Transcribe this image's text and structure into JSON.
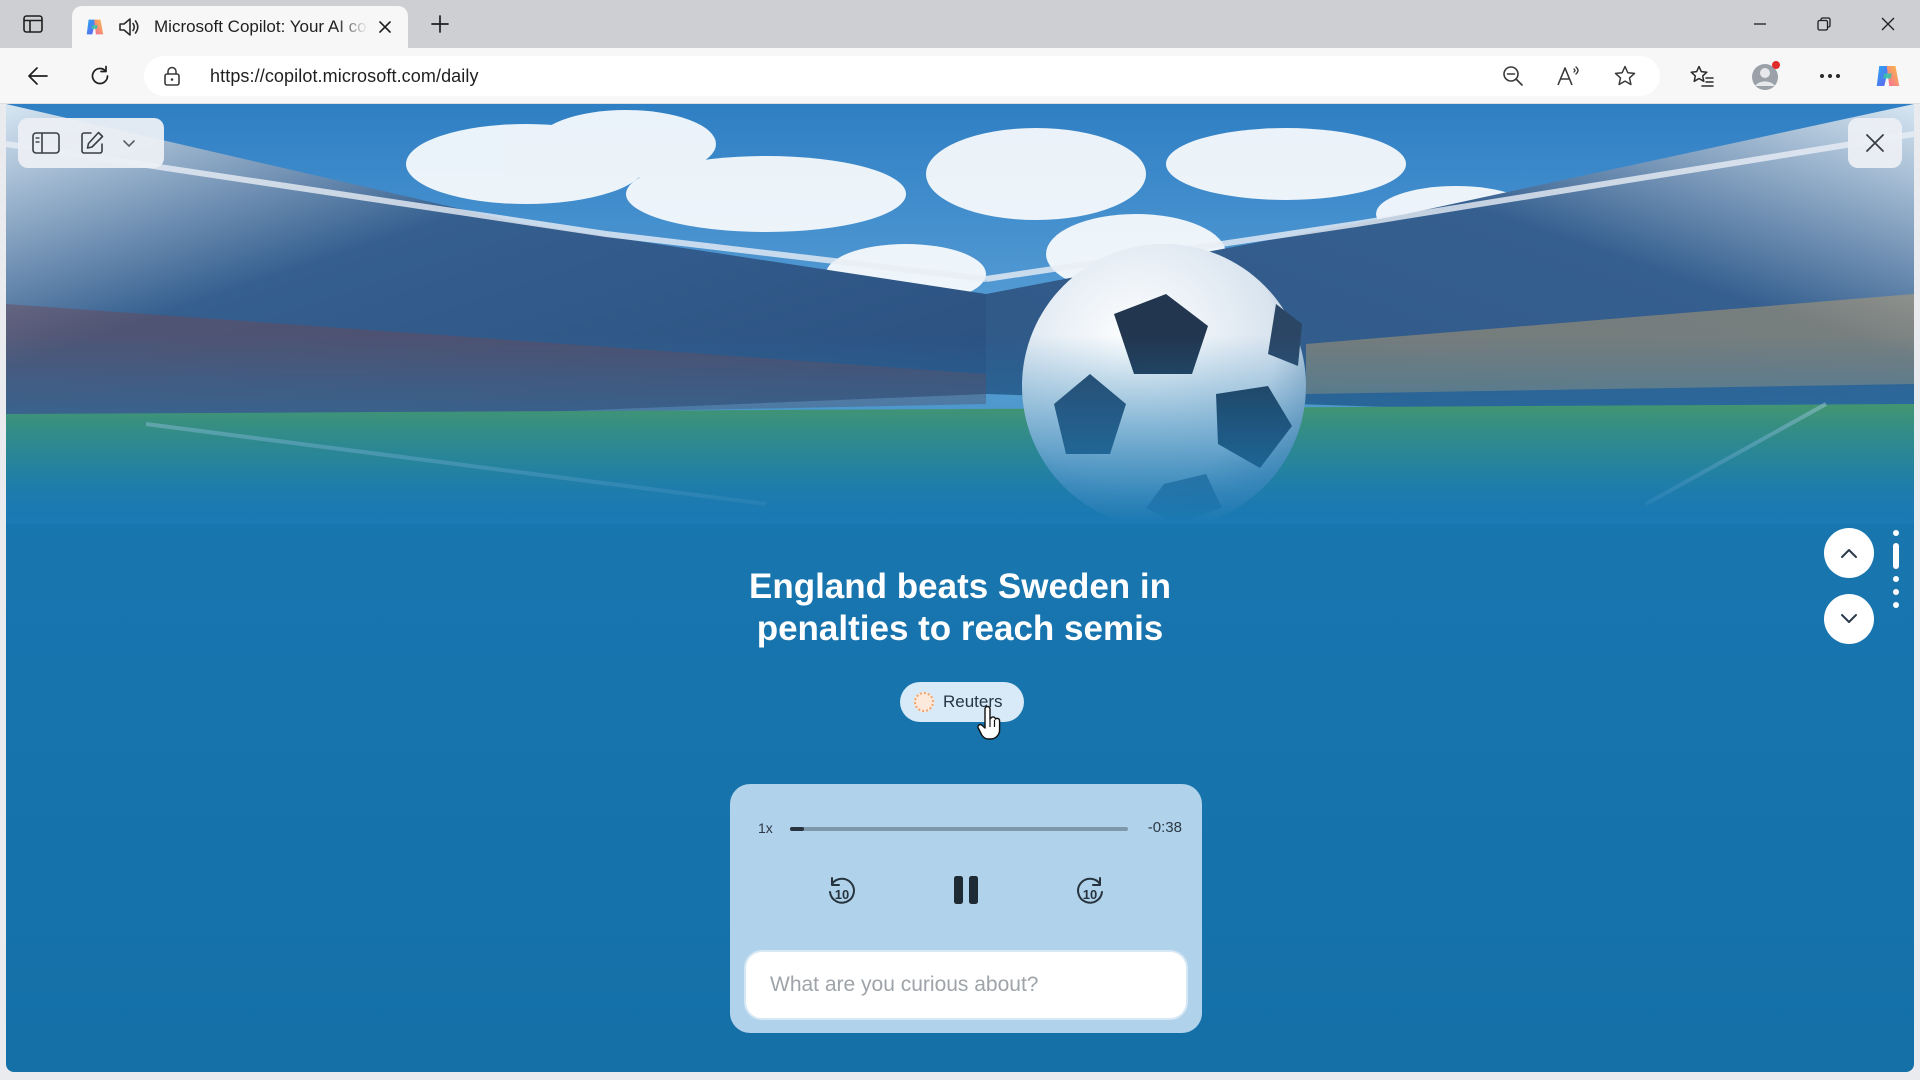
{
  "browser": {
    "tab": {
      "title": "Microsoft Copilot: Your AI companion",
      "favicon": "copilot-icon",
      "audio_icon": "speaker-icon"
    },
    "address_bar": {
      "url": "https://copilot.microsoft.com/daily"
    },
    "icons": {
      "tab_actions": "tab-actions-icon",
      "new_tab": "plus-icon",
      "back": "back-arrow-icon",
      "refresh": "refresh-icon",
      "lock": "lock-icon",
      "zoom": "zoom-out-icon",
      "read_aloud": "read-aloud-icon",
      "favorite": "star-icon",
      "favorites": "favorites-icon",
      "profile": "profile-icon",
      "more": "more-icon",
      "copilot": "copilot-icon",
      "minimize": "minimize-icon",
      "restore": "restore-icon",
      "close": "close-icon"
    }
  },
  "page": {
    "headline_line1": "England beats Sweden in",
    "headline_line2": "penalties to reach semis",
    "source": {
      "name": "Reuters",
      "logo": "reuters-logo"
    },
    "player": {
      "speed": "1x",
      "time_remaining": "-0:38",
      "progress": 0.04,
      "rewind_icon": "rewind-10-icon",
      "pause_icon": "pause-icon",
      "forward_icon": "forward-10-icon",
      "rewind_label": "10",
      "forward_label": "10"
    },
    "ask": {
      "placeholder": "What are you curious about?"
    },
    "story_nav": {
      "total": 5,
      "active_index": 1
    }
  },
  "colors": {
    "page_background": "#1774ad",
    "player_background": "#bedaf0",
    "pill_background": "#d8eaf7",
    "headline": "#ffffff"
  }
}
